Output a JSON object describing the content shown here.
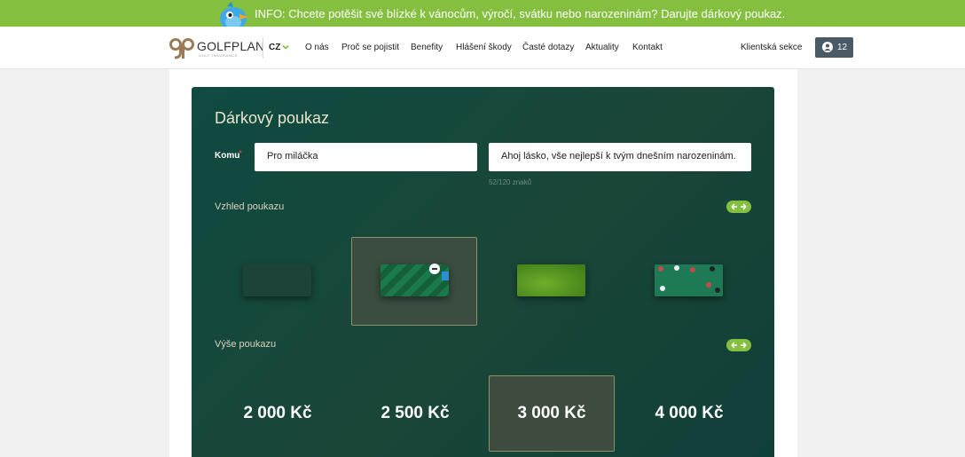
{
  "banner": {
    "text": "INFO: Chcete potěšit své blízké k vánocům, výročí, svátku nebo narozeninám? Darujte dárkový poukaz."
  },
  "header": {
    "logo_text": "GOLFPLAN",
    "logo_subtext": "GOLF INSURANCE",
    "language": "CZ",
    "nav": [
      "O nás",
      "Proč se pojistit",
      "Benefity",
      "Hlášení škody",
      "Časté dotazy",
      "Aktuality",
      "Kontakt"
    ],
    "client_section": "Klientská sekce",
    "cart_count": "12"
  },
  "voucher": {
    "title": "Dárkový poukaz",
    "recipient_label": "Komu",
    "required_mark": "*",
    "recipient_value": "Pro miláčka",
    "message_value": "Ahoj lásko, vše nejlepší k tvým dnešním narozeninám.",
    "char_counter": "52/120 znaků",
    "design_label": "Vzhled poukazu",
    "designs": [
      "dark-green",
      "green-stripes",
      "golf-grass",
      "green-poker"
    ],
    "selected_design_index": 1,
    "amount_label": "Výše poukazu",
    "amounts": [
      "2 000 Kč",
      "2 500 Kč",
      "3 000 Kč",
      "4 000 Kč"
    ],
    "selected_amount_index": 2
  },
  "colors": {
    "banner_green": "#85bf3f",
    "card_dark_green": "#154a3e",
    "selection_border": "#8f9166",
    "cart_button": "#4a5a66"
  },
  "icons": {
    "bird": "bird-mascot-icon",
    "logo": "golfplan-logo-icon",
    "language_chevron": "chevron-down-icon",
    "cart": "user-cart-icon",
    "carousel_arrows": "left-right-arrows-icon"
  }
}
